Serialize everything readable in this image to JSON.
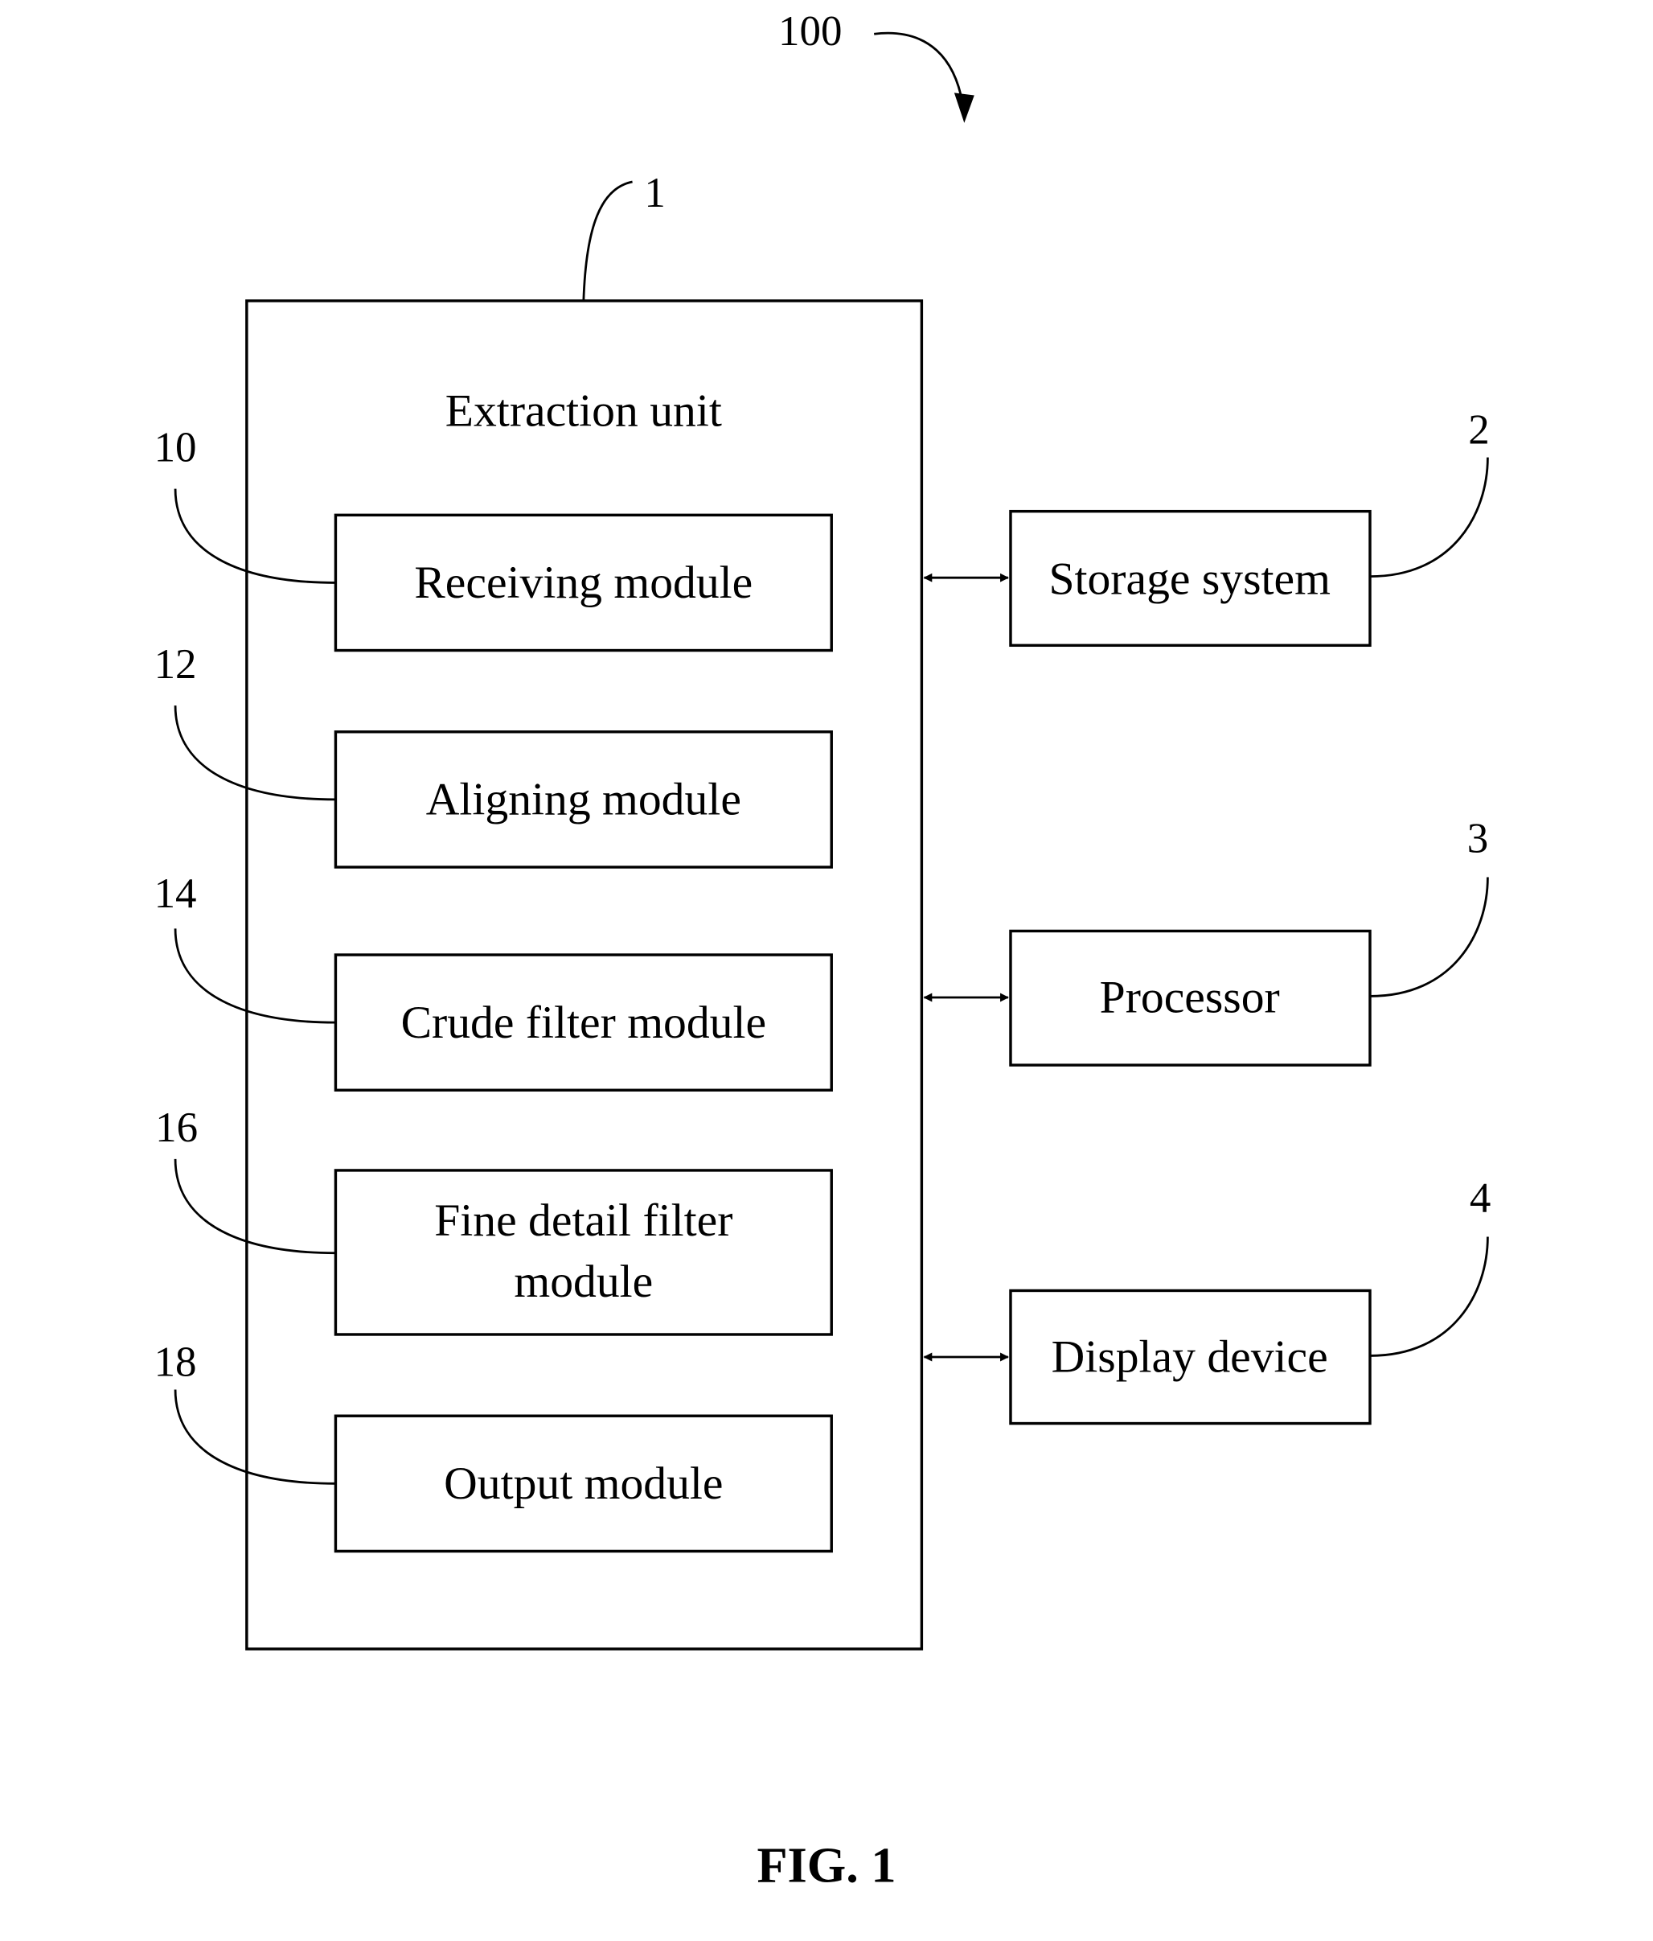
{
  "figure": {
    "caption": "FIG. 1",
    "system_ref": "100"
  },
  "extraction_unit": {
    "ref": "1",
    "label": "Extraction unit",
    "modules": [
      {
        "ref": "10",
        "label_line1": "Receiving module",
        "label_line2": ""
      },
      {
        "ref": "12",
        "label_line1": "Aligning module",
        "label_line2": ""
      },
      {
        "ref": "14",
        "label_line1": "Crude filter module",
        "label_line2": ""
      },
      {
        "ref": "16",
        "label_line1": "Fine detail filter",
        "label_line2": "module"
      },
      {
        "ref": "18",
        "label_line1": "Output module",
        "label_line2": ""
      }
    ]
  },
  "external_blocks": [
    {
      "ref": "2",
      "label": "Storage system"
    },
    {
      "ref": "3",
      "label": "Processor"
    },
    {
      "ref": "4",
      "label": "Display device"
    }
  ]
}
